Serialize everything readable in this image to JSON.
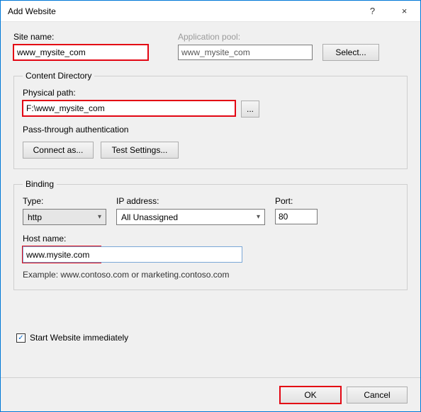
{
  "window": {
    "title": "Add Website",
    "help": "?",
    "close": "×"
  },
  "form": {
    "site_name_label": "Site name:",
    "site_name_value": "www_mysite_com",
    "app_pool_label": "Application pool:",
    "app_pool_value": "www_mysite_com",
    "select_button": "Select..."
  },
  "content_dir": {
    "legend": "Content Directory",
    "path_label": "Physical path:",
    "path_value": "F:\\www_mysite_com",
    "browse": "...",
    "auth_label": "Pass-through authentication",
    "connect_as": "Connect as...",
    "test_settings": "Test Settings..."
  },
  "binding": {
    "legend": "Binding",
    "type_label": "Type:",
    "type_value": "http",
    "ip_label": "IP address:",
    "ip_value": "All Unassigned",
    "port_label": "Port:",
    "port_value": "80",
    "host_label": "Host name:",
    "host_value": "www.mysite.com",
    "example": "Example: www.contoso.com or marketing.contoso.com"
  },
  "start_immediately": {
    "checked": "✓",
    "label": "Start Website immediately"
  },
  "footer": {
    "ok": "OK",
    "cancel": "Cancel"
  }
}
